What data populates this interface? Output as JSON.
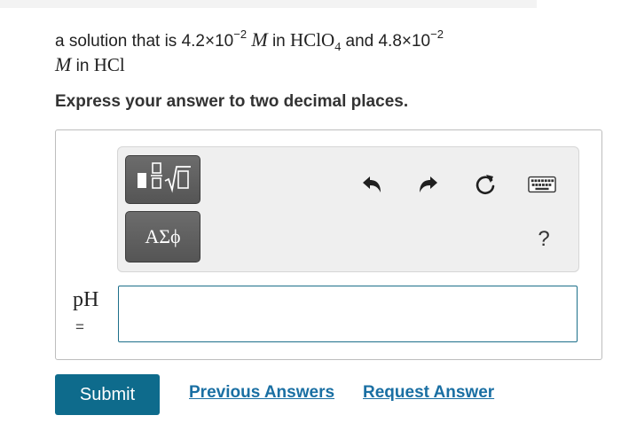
{
  "question": {
    "line1_prefix": "a solution that is 4.2×10",
    "line1_exp1": "−2",
    "unit_M": "M",
    "in_text": " in ",
    "acid1_base": "HClO",
    "acid1_sub": "4",
    "and_text": " and 4.8×10",
    "line1_exp2": "−2",
    "line2_in": " in ",
    "acid2": "HCl"
  },
  "instruction": "Express your answer to two decimal places.",
  "toolbar": {
    "template_icon": "fraction-sqrt-template-icon",
    "greek_label": "ΑΣϕ",
    "undo_icon": "undo-icon",
    "redo_icon": "redo-icon",
    "reset_icon": "reset-icon",
    "keyboard_icon": "keyboard-icon",
    "help_label": "?"
  },
  "answer": {
    "label": "pH",
    "equals": "=",
    "value": ""
  },
  "actions": {
    "submit_label": "Submit",
    "previous_answers_label": "Previous Answers",
    "request_answer_label": "Request Answer"
  },
  "colors": {
    "submit_bg": "#0e6b8c",
    "link": "#1a6fa3",
    "input_border": "#1d6f8a",
    "toolbar_bg": "#efefef"
  }
}
